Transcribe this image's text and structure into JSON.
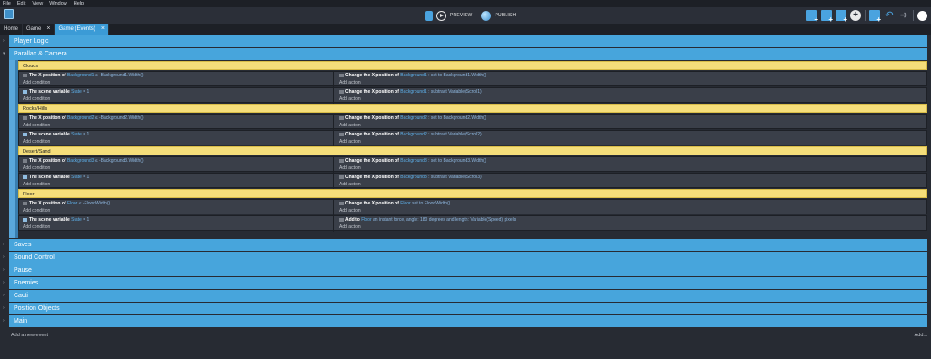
{
  "menu": [
    "File",
    "Edit",
    "View",
    "Window",
    "Help"
  ],
  "toolbar": {
    "preview": "PREVIEW",
    "publish": "PUBLISH"
  },
  "tabs": [
    {
      "label": "Home"
    },
    {
      "label": "Game"
    },
    {
      "label": "Game (Events)"
    }
  ],
  "groups_top": [
    "Player Logic",
    "Parallax & Camera"
  ],
  "comments": [
    "Clouds",
    "Rocks/Hills",
    "Desert/Sand",
    "Floor"
  ],
  "events": [
    {
      "cond_pre": "The X position of",
      "cond_obj": "Background1",
      "cond_post": "≤ -Background1.Width()",
      "act_pre": "Change the X position of",
      "act_obj": "Background1",
      "act_post": ": set to Background1.Width()"
    },
    {
      "cond_pre": "The scene variable",
      "cond_obj": "State",
      "cond_post": "= 1",
      "act_pre": "Change the X position of",
      "act_obj": "Background1",
      "act_post": ": subtract Variable(Scroll1)"
    },
    {
      "cond_pre": "The X position of",
      "cond_obj": "Background2",
      "cond_post": "≤ -Background2.Width()",
      "act_pre": "Change the X position of",
      "act_obj": "Background2",
      "act_post": ": set to Background2.Width()"
    },
    {
      "cond_pre": "The scene variable",
      "cond_obj": "State",
      "cond_post": "= 1",
      "act_pre": "Change the X position of",
      "act_obj": "Background2",
      "act_post": ": subtract Variable(Scroll2)"
    },
    {
      "cond_pre": "The X position of",
      "cond_obj": "Background3",
      "cond_post": "≤ -Background3.Width()",
      "act_pre": "Change the X position of",
      "act_obj": "Background3",
      "act_post": ": set to Background3.Width()"
    },
    {
      "cond_pre": "The scene variable",
      "cond_obj": "State",
      "cond_post": "= 1",
      "act_pre": "Change the X position of",
      "act_obj": "Background3",
      "act_post": ": subtract Variable(Scroll3)"
    },
    {
      "cond_pre": "The X position of",
      "cond_obj": "Floor",
      "cond_post": "≤ -Floor.Width()",
      "act_pre": "Change the X position of",
      "act_obj": "Floor",
      "act_post": "set to Floor.Width()"
    },
    {
      "cond_pre": "The scene variable",
      "cond_obj": "State",
      "cond_post": "= 1",
      "act_pre": "Add to",
      "act_obj": "Floor",
      "act_post": "an instant force, angle: 180 degrees and length: Variable(Speed) pixels"
    }
  ],
  "add_condition": "Add condition",
  "add_action": "Add action",
  "groups_bottom": [
    "Saves",
    "Sound Control",
    "Pause",
    "Enemies",
    "Cacti",
    "Position Objects",
    "Main"
  ],
  "footer": {
    "add_event": "Add a new event",
    "add_more": "Add..."
  },
  "colors": {
    "group": "#47a5dc",
    "comment": "#f5de7a",
    "background": "#272b33",
    "event": "#3a3f49"
  }
}
